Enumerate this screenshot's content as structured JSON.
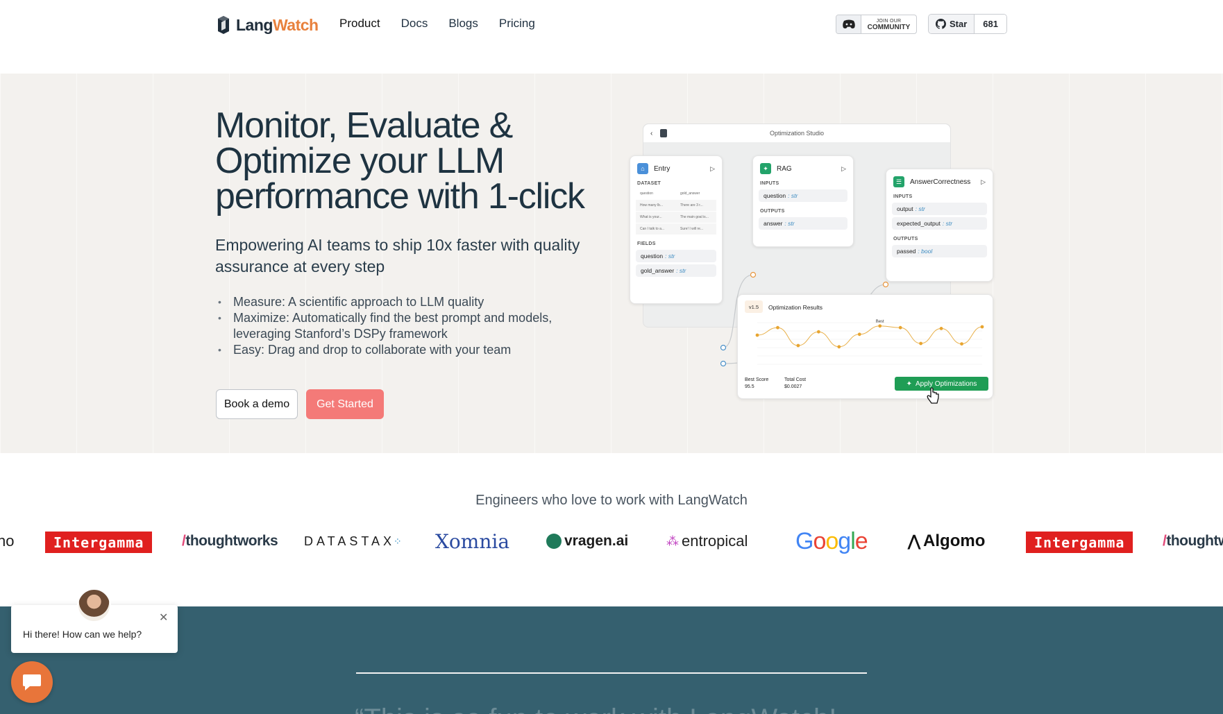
{
  "nav": {
    "brand_a": "Lang",
    "brand_b": "Watch",
    "links": [
      "Product",
      "Docs",
      "Blogs",
      "Pricing"
    ],
    "discord_line1": "JOIN OUR",
    "discord_line2": "COMMUNITY",
    "star_label": "Star",
    "star_count": "681"
  },
  "hero": {
    "title": "Monitor, Evaluate & Optimize your LLM performance with 1-click",
    "subtitle": "Empowering AI teams to ship 10x faster with quality assurance at every step",
    "bullets": [
      "Measure: A scientific approach to LLM quality",
      "Maximize: Automatically find the best prompt and models, leveraging Stanford’s DSPy framework",
      "Easy: Drag and drop to collaborate with your team"
    ],
    "demo_button": "Book a demo",
    "start_button": "Get Started"
  },
  "studio": {
    "title": "Optimization Studio",
    "entry": {
      "name": "Entry",
      "dataset_label": "DATASET",
      "cols": [
        "question",
        "gold_answer"
      ],
      "rows": [
        [
          "How many lb...",
          "There are 3 r..."
        ],
        [
          "What is your...",
          "The main goal is..."
        ],
        [
          "Can I talk to a...",
          "Sure! I will re..."
        ]
      ],
      "fields_label": "FIELDS",
      "field1": "question",
      "field1_type": ": str",
      "field2": "gold_answer",
      "field2_type": ": str"
    },
    "rag": {
      "name": "RAG",
      "inputs_label": "INPUTS",
      "in1": "question",
      "in1_type": ": str",
      "outputs_label": "OUTPUTS",
      "out1": "answer",
      "out1_type": ": str"
    },
    "correctness": {
      "name": "AnswerCorrectness",
      "inputs_label": "INPUTS",
      "in1": "output",
      "in1_type": ": str",
      "in2": "expected_output",
      "in2_type": ": str",
      "outputs_label": "OUTPUTS",
      "out1": "passed",
      "out1_type": ": bool"
    },
    "results": {
      "version": "v1.5",
      "title": "Optimization Results",
      "best_label": "Best",
      "best_score_label": "Best Score",
      "best_score": "95.5",
      "total_cost_label": "Total Cost",
      "total_cost": "$0.0027",
      "apply_button": "Apply Optimizations",
      "series": [
        70,
        88,
        45,
        78,
        42,
        72,
        92,
        88,
        50,
        86,
        49,
        90
      ]
    }
  },
  "logos": {
    "title": "Engineers who love to work with LangWatch",
    "items": [
      "no",
      "Intergamma",
      "thoughtworks",
      "DATASTAX",
      "Xomnia",
      "vragen.ai",
      "entropical",
      "Google",
      "Algomo",
      "Intergamma",
      "thoughtw"
    ]
  },
  "testimonial": {
    "quote_start": "“This is so fun to work with LangWatch!"
  },
  "chat": {
    "message": "Hi there! How can we help?"
  },
  "colors": {
    "accent_orange": "#e8813d",
    "cta_pink": "#f47a78",
    "apply_green": "#1f9d55",
    "dark_section": "#35606f"
  }
}
